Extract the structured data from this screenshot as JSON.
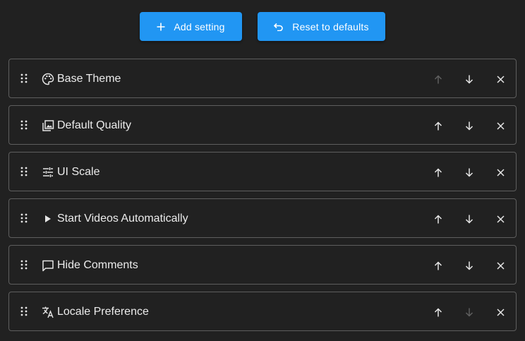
{
  "toolbar": {
    "add_label": "Add setting",
    "reset_label": "Reset to defaults",
    "accent": "#2196f3"
  },
  "settings": [
    {
      "label": "Base Theme",
      "icon": "palette-icon",
      "up_enabled": false,
      "down_enabled": true
    },
    {
      "label": "Default Quality",
      "icon": "photo-library-icon",
      "up_enabled": true,
      "down_enabled": true
    },
    {
      "label": "UI Scale",
      "icon": "tune-icon",
      "up_enabled": true,
      "down_enabled": true
    },
    {
      "label": "Start Videos Automatically",
      "icon": "play-icon",
      "up_enabled": true,
      "down_enabled": true
    },
    {
      "label": "Hide Comments",
      "icon": "comment-icon",
      "up_enabled": true,
      "down_enabled": true
    },
    {
      "label": "Locale Preference",
      "icon": "translate-icon",
      "up_enabled": true,
      "down_enabled": false
    }
  ],
  "colors": {
    "background": "#212121",
    "border": "#5e5e5e",
    "icon_enabled": "#e6e6e6",
    "icon_disabled": "#5f5f5f"
  }
}
